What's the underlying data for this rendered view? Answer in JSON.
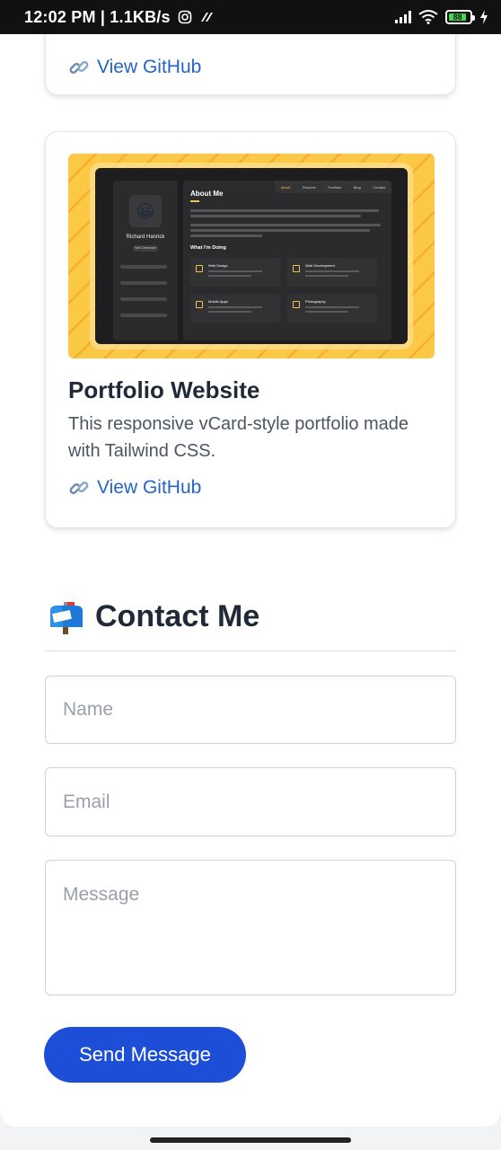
{
  "status_bar": {
    "time": "12:02 PM",
    "speed": "1.1KB/s",
    "battery": "88"
  },
  "projects": [
    {
      "link_label": "View GitHub"
    },
    {
      "title": "Portfolio Website",
      "description": "This responsive vCard-style portfolio made with Tailwind CSS.",
      "link_label": "View GitHub",
      "preview": {
        "name": "Richard Hanrick",
        "heading": "About Me",
        "subheading": "What I'm Doing",
        "nav": [
          "About",
          "Resume",
          "Portfolio",
          "Blog",
          "Contact"
        ],
        "services": [
          "Web Design",
          "Web Development",
          "Mobile Apps",
          "Photography"
        ]
      }
    }
  ],
  "contact": {
    "title": "Contact Me",
    "name_placeholder": "Name",
    "email_placeholder": "Email",
    "message_placeholder": "Message",
    "send_label": "Send Message"
  }
}
